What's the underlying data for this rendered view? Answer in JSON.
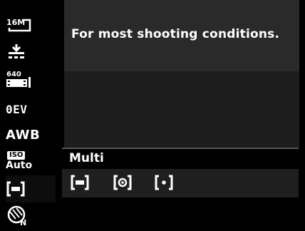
{
  "sidebar": {
    "items": [
      {
        "name": "image-size",
        "label": "16M"
      },
      {
        "name": "quality",
        "label": ""
      },
      {
        "name": "video-size",
        "label": "640"
      },
      {
        "name": "exposure",
        "label": "0EV"
      },
      {
        "name": "white-balance",
        "label": "AWB"
      },
      {
        "name": "iso",
        "label": "ISO",
        "sub": "Auto"
      },
      {
        "name": "metering",
        "label": ""
      },
      {
        "name": "color-effect",
        "label": ""
      }
    ]
  },
  "description": "For most shooting conditions.",
  "metering": {
    "selected_label": "Multi",
    "options": [
      "multi-icon",
      "center-icon",
      "spot-icon"
    ]
  },
  "colors": {
    "panel": "#2a2a2a",
    "bg": "#000000",
    "text": "#ffffff"
  }
}
